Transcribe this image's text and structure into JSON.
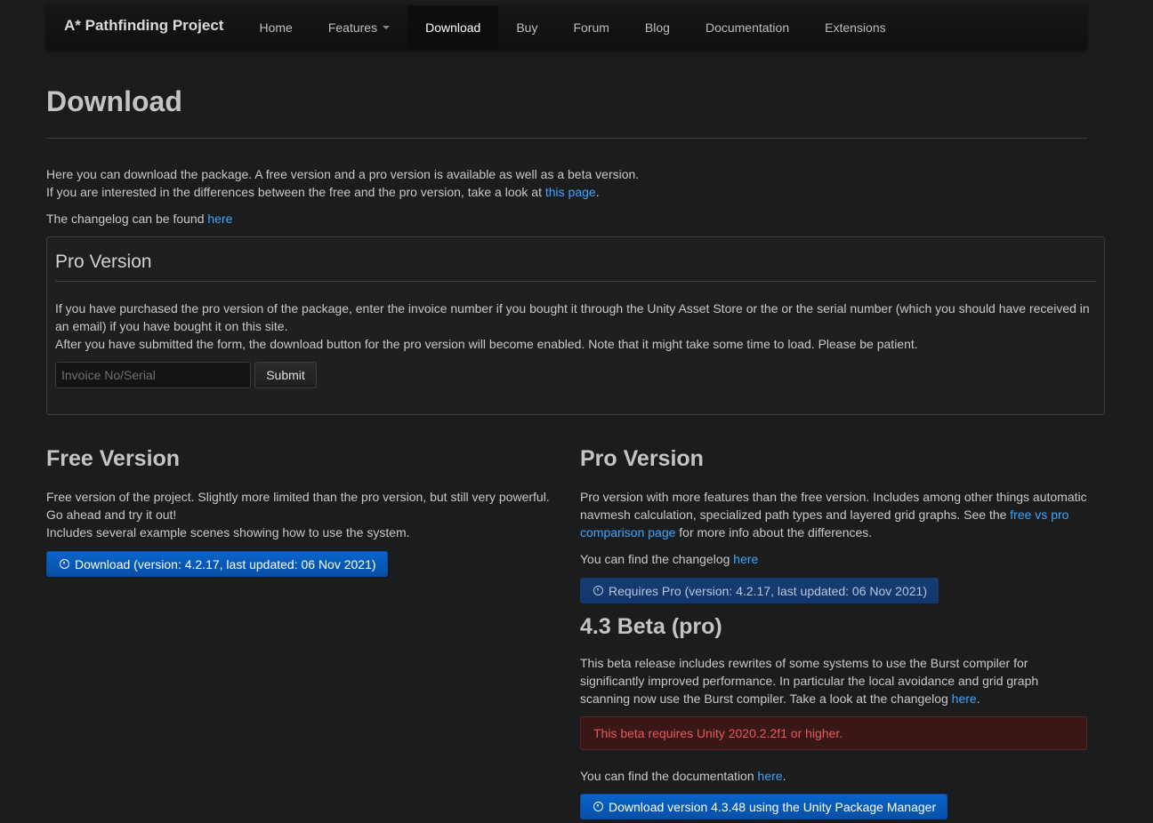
{
  "nav": {
    "brand": "A* Pathfinding Project",
    "items": [
      {
        "label": "Home"
      },
      {
        "label": "Features"
      },
      {
        "label": "Download"
      },
      {
        "label": "Buy"
      },
      {
        "label": "Forum"
      },
      {
        "label": "Blog"
      },
      {
        "label": "Documentation"
      },
      {
        "label": "Extensions"
      }
    ],
    "active": "Download"
  },
  "page": {
    "title": "Download",
    "intro_line1": "Here you can download the package. A free version and a pro version is available as well as a beta version.",
    "intro_line2_pre": "If you are interested in the differences between the free and the pro version, take a look at ",
    "intro_line2_link": "this page",
    "intro_line2_post": ".",
    "changelog_pre": "The changelog can be found ",
    "changelog_link": "here"
  },
  "pro_box": {
    "title": "Pro Version",
    "text1": "If you have purchased the pro version of the package, enter the invoice number if you bought it through the Unity Asset Store or the or the serial number (which you should have received in an email) if you have bought it on this site.",
    "text2": "After you have submitted the form, the download button for the pro version will become enabled. Note that it might take some time to load. Please be patient.",
    "input_placeholder": "Invoice No/Serial",
    "submit_label": "Submit"
  },
  "free": {
    "title": "Free Version",
    "line1": "Free version of the project. Slightly more limited than the pro version, but still very powerful.",
    "line2": "Go ahead and try it out!",
    "line3": "Includes several example scenes showing how to use the system.",
    "download_label": "Download (version: 4.2.17, last updated: 06 Nov 2021)"
  },
  "pro": {
    "title": "Pro Version",
    "desc_pre": "Pro version with more features than the free version. Includes among other things automatic navmesh calculation, specialized path types and layered grid graphs. See the ",
    "desc_link": "free vs pro comparison page",
    "desc_post": " for more info about the differences.",
    "changelog_pre": "You can find the changelog ",
    "changelog_link": "here",
    "button_label": "Requires Pro (version: 4.2.17, last updated: 06 Nov 2021)"
  },
  "beta": {
    "title": "4.3 Beta (pro)",
    "desc_pre": "This beta release includes rewrites of some systems to use the Burst compiler for significantly improved performance. In particular the local avoidance and grid graph scanning now use the Burst compiler. Take a look at the changelog ",
    "desc_link": "here",
    "desc_post": ".",
    "alert": "This beta requires Unity 2020.2.2f1 or higher.",
    "docs_pre": "You can find the documentation ",
    "docs_link": "here",
    "docs_post": ".",
    "button_label": "Download version 4.3.48 using the Unity Package Manager"
  },
  "colors": {
    "background": "#1b1c1e",
    "link": "#3aa7ff",
    "primary_button": "#0a5cbf",
    "danger_text": "#e45a5a",
    "danger_bg": "#3a1717"
  }
}
